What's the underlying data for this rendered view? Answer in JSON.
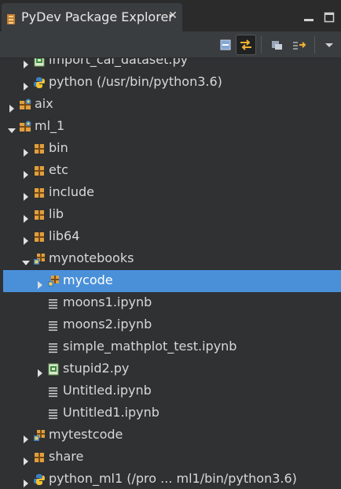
{
  "view": {
    "title": "PyDev Package Explorer",
    "close_glyph": "✕",
    "icon": "pydev-explorer-icon"
  },
  "toolbar": {
    "buttons": [
      "collapse-all-icon",
      "link-with-editor-icon",
      "filters-icon",
      "focus-icon",
      "view-menu-icon"
    ]
  },
  "tree": [
    {
      "label": "import_cal_dataset.py",
      "icon": "python-file-icon",
      "expand": "collapsed"
    },
    {
      "label": "python  (/usr/bin/python3.6)",
      "icon": "python-interpreter-icon",
      "expand": "collapsed"
    },
    {
      "label": "aix",
      "icon": "project-icon",
      "expand": "collapsed"
    },
    {
      "label": "ml_1",
      "icon": "project-icon",
      "expand": "expanded"
    },
    {
      "label": "bin",
      "icon": "folder-icon",
      "expand": "collapsed"
    },
    {
      "label": "etc",
      "icon": "folder-icon",
      "expand": "collapsed"
    },
    {
      "label": "include",
      "icon": "folder-icon",
      "expand": "collapsed"
    },
    {
      "label": "lib",
      "icon": "folder-icon",
      "expand": "collapsed"
    },
    {
      "label": "lib64",
      "icon": "folder-icon",
      "expand": "collapsed"
    },
    {
      "label": "mynotebooks",
      "icon": "source-folder-icon",
      "expand": "expanded"
    },
    {
      "label": "mycode",
      "icon": "package-icon",
      "expand": "collapsed",
      "selected": true
    },
    {
      "label": "moons1.ipynb",
      "icon": "text-file-icon",
      "expand": "none"
    },
    {
      "label": "moons2.ipynb",
      "icon": "text-file-icon",
      "expand": "none"
    },
    {
      "label": "simple_mathplot_test.ipynb",
      "icon": "text-file-icon",
      "expand": "none"
    },
    {
      "label": "stupid2.py",
      "icon": "python-file-icon",
      "expand": "collapsed"
    },
    {
      "label": "Untitled.ipynb",
      "icon": "text-file-icon",
      "expand": "none"
    },
    {
      "label": "Untitled1.ipynb",
      "icon": "text-file-icon",
      "expand": "none"
    },
    {
      "label": "mytestcode",
      "icon": "source-folder-icon",
      "expand": "collapsed"
    },
    {
      "label": "share",
      "icon": "folder-icon",
      "expand": "collapsed"
    },
    {
      "label": "python_ml1  (/pro ... ml1/bin/python3.6)",
      "icon": "python-interpreter-icon",
      "expand": "collapsed"
    }
  ],
  "colors": {
    "background": "#2f3133",
    "selection": "#4a90d9",
    "text": "#d8d8d8"
  }
}
